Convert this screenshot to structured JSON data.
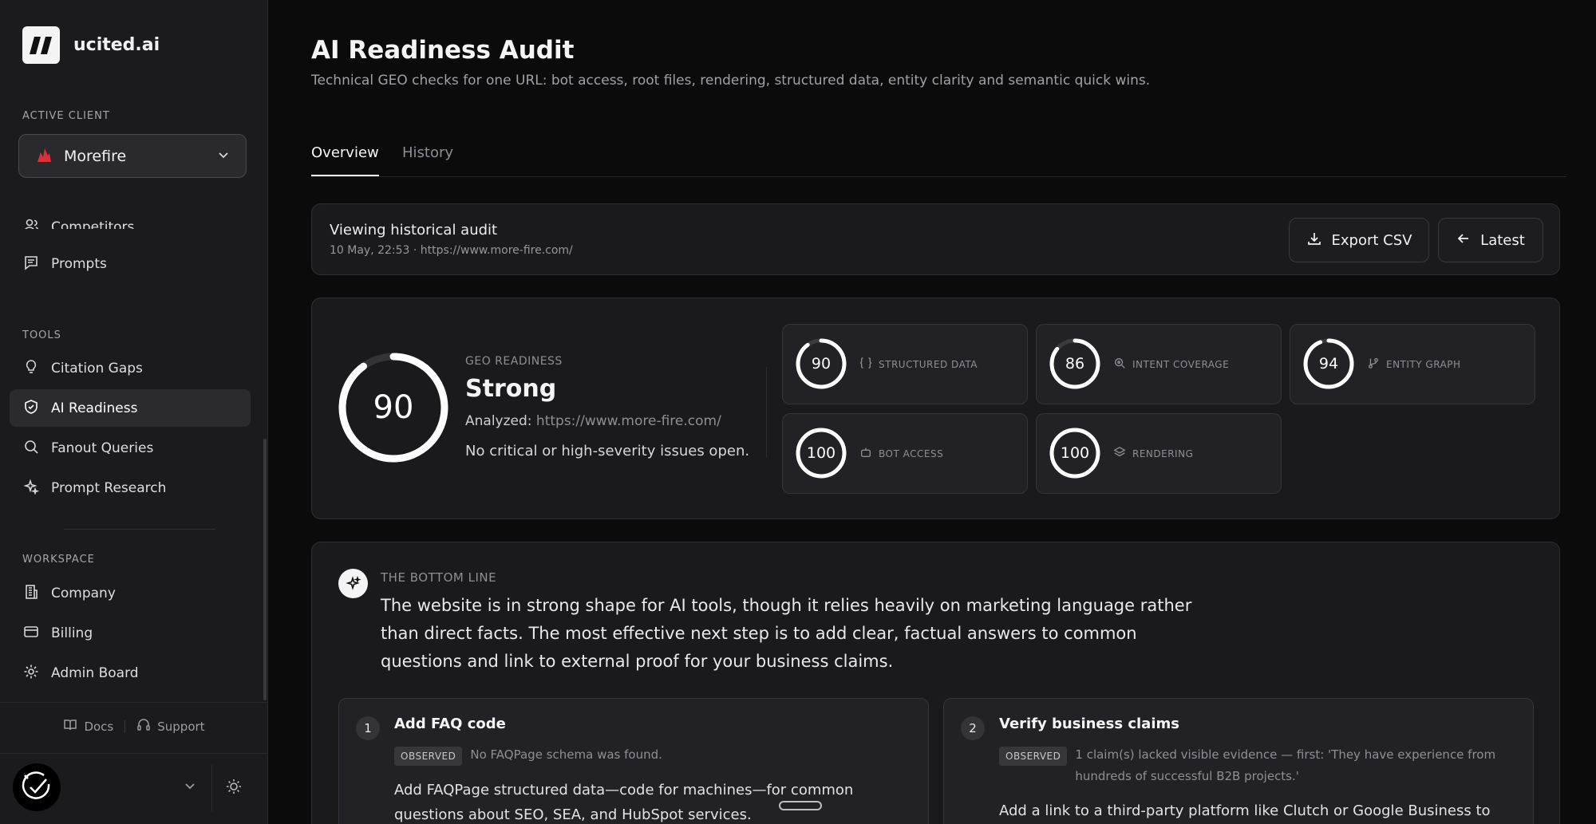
{
  "brand": {
    "name": "ucited.ai"
  },
  "sidebar": {
    "active_client_label": "ACTIVE CLIENT",
    "client": "Morefire",
    "top_items": [
      {
        "label": "Competitors",
        "icon": "users-icon"
      },
      {
        "label": "Prompts",
        "icon": "message-icon"
      }
    ],
    "tools_label": "TOOLS",
    "tools": [
      {
        "label": "Citation Gaps",
        "icon": "lightbulb-icon"
      },
      {
        "label": "AI Readiness",
        "icon": "shield-icon",
        "active": true
      },
      {
        "label": "Fanout Queries",
        "icon": "search-icon"
      },
      {
        "label": "Prompt Research",
        "icon": "sparkles-icon"
      }
    ],
    "workspace_label": "WORKSPACE",
    "workspace": [
      {
        "label": "Company",
        "icon": "building-icon"
      },
      {
        "label": "Billing",
        "icon": "credit-card-icon"
      },
      {
        "label": "Admin Board",
        "icon": "gear-icon"
      }
    ],
    "footer": {
      "docs": "Docs",
      "support": "Support"
    }
  },
  "header": {
    "title": "AI Readiness Audit",
    "subtitle": "Technical GEO checks for one URL: bot access, root files, rendering, structured data, entity clarity and semantic quick wins."
  },
  "tabs": [
    {
      "label": "Overview",
      "active": true
    },
    {
      "label": "History",
      "active": false
    }
  ],
  "history": {
    "title": "Viewing historical audit",
    "meta": "10 May, 22:53 · https://www.more-fire.com/",
    "export_label": "Export CSV",
    "latest_label": "Latest"
  },
  "score": {
    "value": "90",
    "value_fraction": 0.9,
    "label": "GEO READINESS",
    "status": "Strong",
    "analyzed_label": "Analyzed:",
    "analyzed_url": "https://www.more-fire.com/",
    "issues": "No critical or high-severity issues open."
  },
  "metrics": [
    {
      "value": "90",
      "fraction": 0.9,
      "label": "STRUCTURED DATA",
      "icon": "braces-icon"
    },
    {
      "value": "86",
      "fraction": 0.86,
      "label": "INTENT COVERAGE",
      "icon": "search-target-icon"
    },
    {
      "value": "94",
      "fraction": 0.94,
      "label": "ENTITY GRAPH",
      "icon": "git-branch-icon"
    },
    {
      "value": "100",
      "fraction": 1.0,
      "label": "BOT ACCESS",
      "icon": "bot-icon"
    },
    {
      "value": "100",
      "fraction": 1.0,
      "label": "RENDERING",
      "icon": "layers-icon"
    }
  ],
  "bottom_line": {
    "label": "THE BOTTOM LINE",
    "text": "The website is in strong shape for AI tools, though it relies heavily on marketing language rather than direct facts. The most effective next step is to add clear, factual answers to common questions and link to external proof for your business claims."
  },
  "steps": [
    {
      "num": "1",
      "title": "Add FAQ code",
      "tag": "OBSERVED",
      "observed": "No FAQPage schema was found.",
      "body": "Add FAQPage structured data—code for machines—for common questions about SEO, SEA, and HubSpot services."
    },
    {
      "num": "2",
      "title": "Verify business claims",
      "tag": "OBSERVED",
      "observed": "1 claim(s) lacked visible evidence — first: 'They have experience from hundreds of successful B2B projects.'",
      "body": "Add a link to a third-party platform like Clutch or Google Business to verify"
    }
  ],
  "colors": {
    "background": "#0b0b0c",
    "sidebar": "#1b1b1e",
    "card": "#1a1a1d",
    "accent_client": "#d8313a",
    "ring": "#ffffff"
  }
}
